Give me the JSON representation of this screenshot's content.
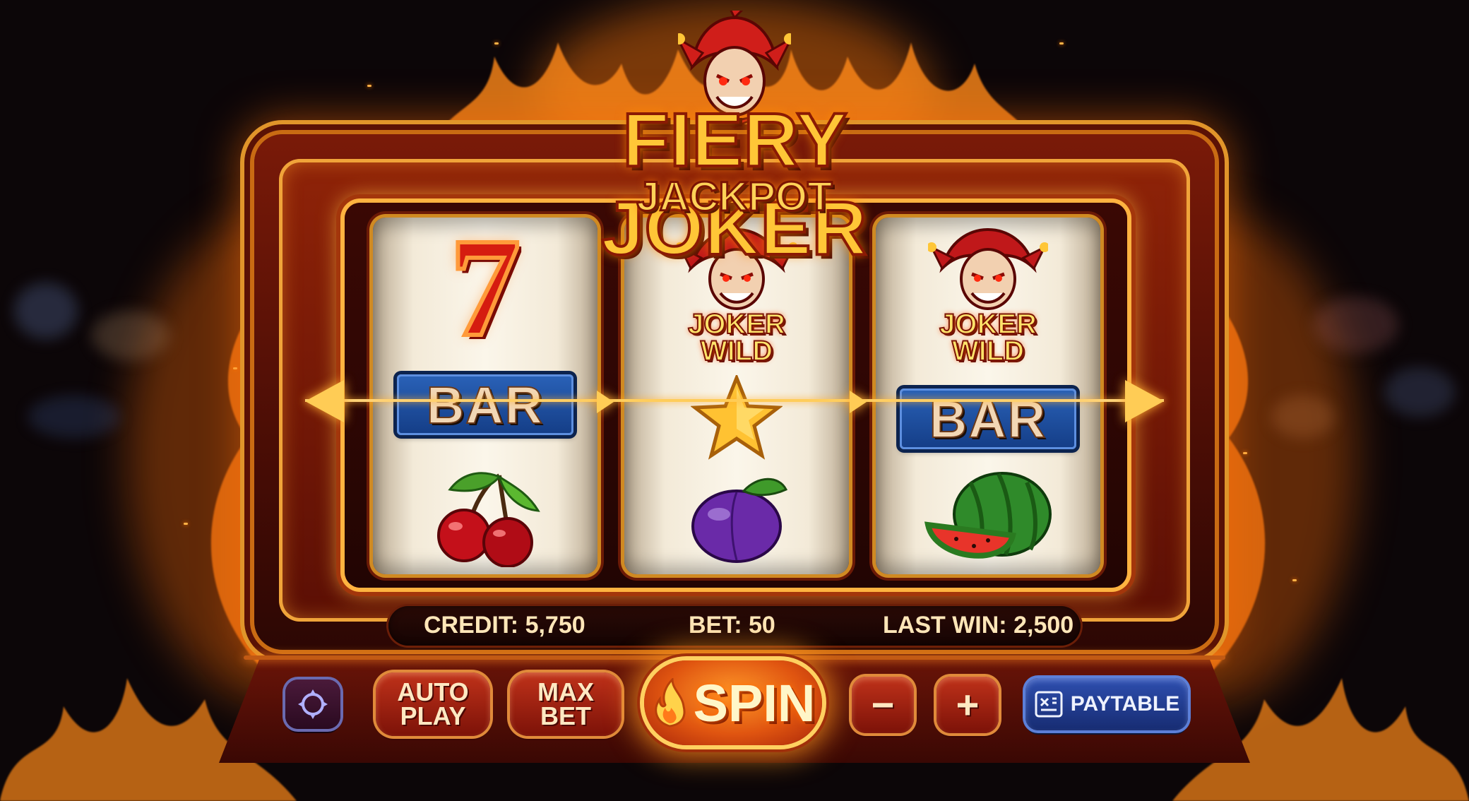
{
  "title": {
    "line1_left": "FIERY",
    "line1_right": "JOKER",
    "line2": "JACKPOT"
  },
  "reels": [
    {
      "top": "7",
      "middle": "BAR",
      "bottom": "cherry-icon"
    },
    {
      "top_line1": "JOKER",
      "top_line2": "WILD",
      "middle": "star-icon",
      "bottom": "plum-icon"
    },
    {
      "top_line1": "JOKER",
      "top_line2": "WILD",
      "middle": "BAR",
      "bottom": "watermelon-icon"
    }
  ],
  "info": {
    "credit_label": "CREDIT:",
    "credit_value": "5,750",
    "bet_label": "BET:",
    "bet_value": "50",
    "last_win_label": "LAST WIN:",
    "last_win_value": "2,500"
  },
  "controls": {
    "settings_icon": "settings-icon",
    "autoplay_line1": "AUTO",
    "autoplay_line2": "PLAY",
    "maxbet_line1": "MAX",
    "maxbet_line2": "BET",
    "spin_label": "SPIN",
    "minus_label": "−",
    "plus_label": "+",
    "paytable_label": "PAYTABLE"
  },
  "colors": {
    "accent_gold": "#ffc637",
    "fire_orange": "#ff7a00",
    "button_red": "#c0321a",
    "button_blue": "#2e4fb0"
  }
}
